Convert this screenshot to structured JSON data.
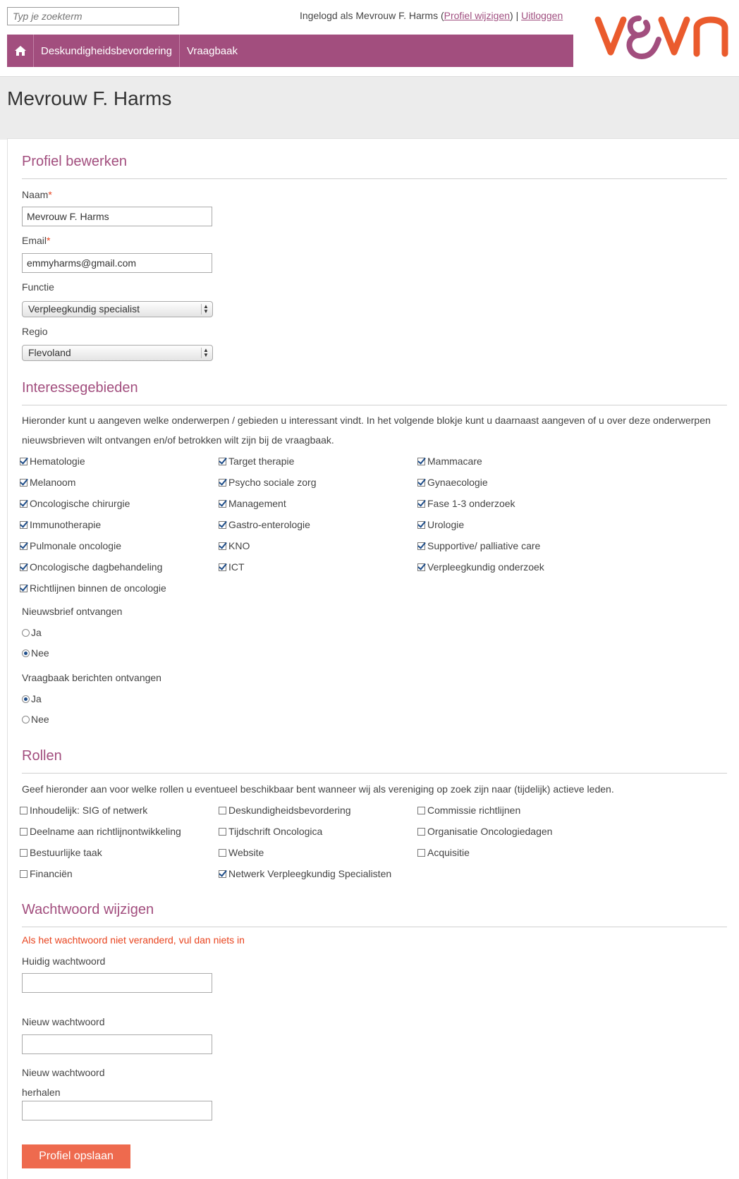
{
  "header": {
    "search_placeholder": "Typ je zoekterm",
    "logged_in_prefix": "Ingelogd als Mevrouw F. Harms",
    "profile_link": "Profiel wijzigen",
    "logout_link": "Uitloggen",
    "logo_text": "v&vn"
  },
  "nav": {
    "home_icon": "home-icon",
    "items": [
      "Deskundigheidsbevordering",
      "Vraagbaak"
    ]
  },
  "page_title": "Mevrouw F. Harms",
  "profile": {
    "title": "Profiel bewerken",
    "name_label": "Naam",
    "name_value": "Mevrouw F. Harms",
    "email_label": "Email",
    "email_value": "emmyharms@gmail.com",
    "function_label": "Functie",
    "function_value": "Verpleegkundig specialist",
    "region_label": "Regio",
    "region_value": "Flevoland",
    "required_mark": "*"
  },
  "interests": {
    "title": "Interessegebieden",
    "intro": "Hieronder kunt u aangeven welke onderwerpen / gebieden u interessant vindt. In het volgende blokje kunt u daarnaast aangeven of u over deze onderwerpen nieuwsbrieven wilt ontvangen en/of betrokken wilt zijn bij de vraagbaak.",
    "col1": [
      {
        "label": "Hematologie",
        "checked": true
      },
      {
        "label": "Melanoom",
        "checked": true
      },
      {
        "label": "Oncologische chirurgie",
        "checked": true
      },
      {
        "label": "Immunotherapie",
        "checked": true
      },
      {
        "label": "Pulmonale oncologie",
        "checked": true
      },
      {
        "label": "Oncologische dagbehandeling",
        "checked": true
      },
      {
        "label": "Richtlijnen binnen de oncologie",
        "checked": true
      }
    ],
    "col2": [
      {
        "label": "Target therapie",
        "checked": true
      },
      {
        "label": "Psycho sociale zorg",
        "checked": true
      },
      {
        "label": "Management",
        "checked": true
      },
      {
        "label": "Gastro-enterologie",
        "checked": true
      },
      {
        "label": "KNO",
        "checked": true
      },
      {
        "label": "ICT",
        "checked": true
      }
    ],
    "col3": [
      {
        "label": "Mammacare",
        "checked": true
      },
      {
        "label": "Gynaecologie",
        "checked": true
      },
      {
        "label": "Fase 1-3 onderzoek",
        "checked": true
      },
      {
        "label": "Urologie",
        "checked": true
      },
      {
        "label": "Supportive/ palliative care",
        "checked": true
      },
      {
        "label": "Verpleegkundig onderzoek",
        "checked": true
      }
    ],
    "newsletter_label": "Nieuwsbrief ontvangen",
    "newsletter_options": [
      {
        "label": "Ja",
        "selected": false
      },
      {
        "label": "Nee",
        "selected": true
      }
    ],
    "qa_label": "Vraagbaak berichten ontvangen",
    "qa_options": [
      {
        "label": "Ja",
        "selected": true
      },
      {
        "label": "Nee",
        "selected": false
      }
    ]
  },
  "roles": {
    "title": "Rollen",
    "intro": "Geef hieronder aan voor welke rollen u eventueel beschikbaar bent wanneer wij als vereniging op zoek zijn naar (tijdelijk) actieve leden.",
    "col1": [
      {
        "label": "Inhoudelijk: SIG of netwerk",
        "checked": false
      },
      {
        "label": "Deelname aan richtlijnontwikkeling",
        "checked": false
      },
      {
        "label": "Bestuurlijke taak",
        "checked": false
      },
      {
        "label": "Financiën",
        "checked": false
      }
    ],
    "col2": [
      {
        "label": "Deskundigheidsbevordering",
        "checked": false
      },
      {
        "label": "Tijdschrift Oncologica",
        "checked": false
      },
      {
        "label": "Website",
        "checked": false
      },
      {
        "label": "Netwerk Verpleegkundig Specialisten",
        "checked": true
      }
    ],
    "col3": [
      {
        "label": "Commissie richtlijnen",
        "checked": false
      },
      {
        "label": "Organisatie Oncologiedagen",
        "checked": false
      },
      {
        "label": "Acquisitie",
        "checked": false
      }
    ]
  },
  "password": {
    "title": "Wachtwoord wijzigen",
    "notice": "Als het wachtwoord niet veranderd, vul dan niets in",
    "current_label": "Huidig wachtwoord",
    "new_label": "Nieuw wachtwoord",
    "repeat_label_line1": "Nieuw wachtwoord",
    "repeat_label_line2": "herhalen"
  },
  "save_button": "Profiel opslaan",
  "colors": {
    "brand_purple": "#a24e7e",
    "accent_orange": "#ee6a4e",
    "logo_orange": "#ea5b2d"
  }
}
